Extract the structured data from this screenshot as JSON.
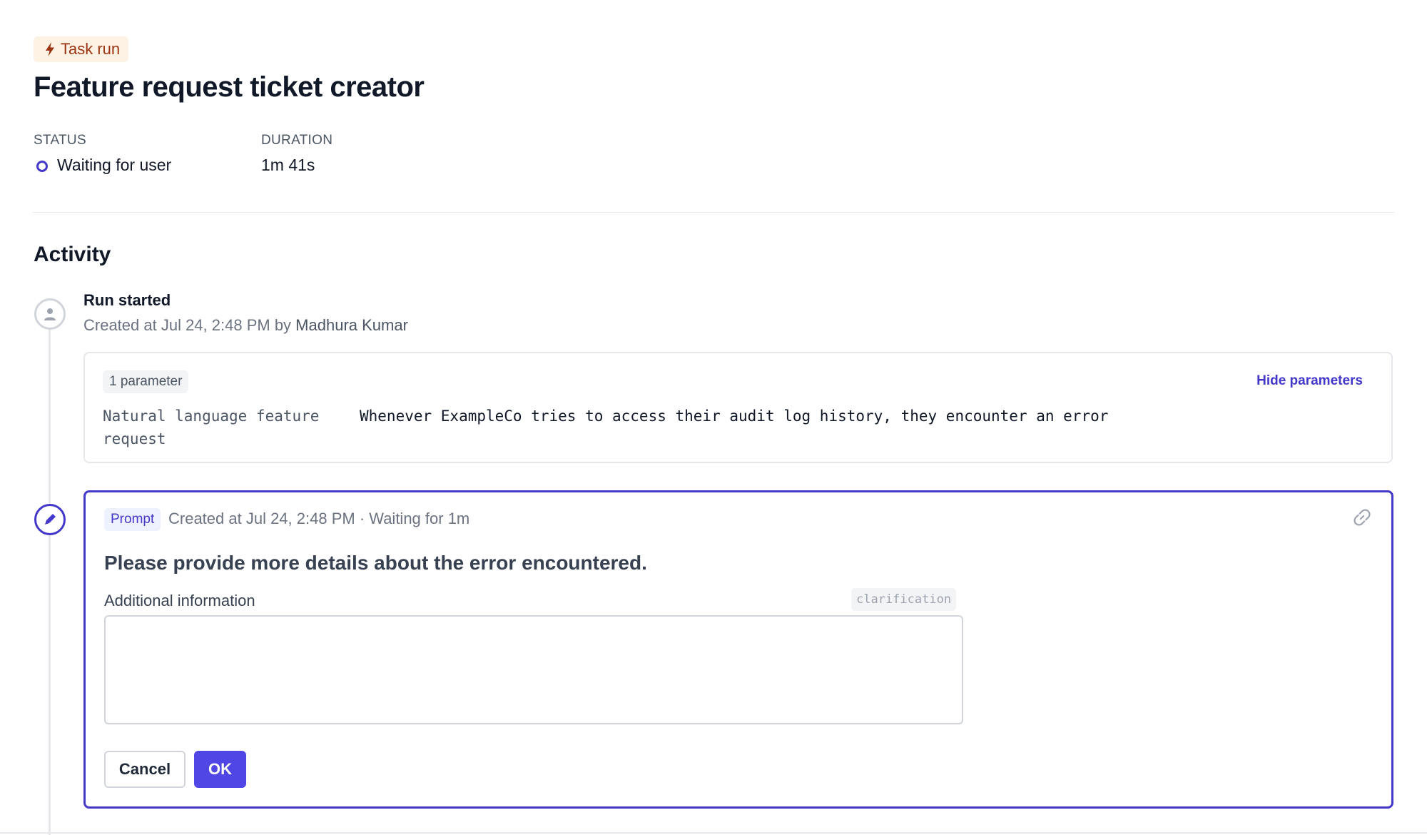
{
  "header": {
    "badge_label": "Task run",
    "badge_icon": "lightning-bolt-icon",
    "title": "Feature request ticket creator"
  },
  "meta": {
    "status_label": "STATUS",
    "status_value": "Waiting for user",
    "duration_label": "DURATION",
    "duration_value": "1m 41s"
  },
  "activity": {
    "section_title": "Activity",
    "run_started": {
      "title": "Run started",
      "subtitle_prefix": "Created at Jul 24, 2:48 PM by ",
      "user": "Madhura Kumar",
      "parameters": {
        "count_label": "1 parameter",
        "toggle_label": "Hide parameters",
        "items": [
          {
            "key": "Natural language feature request",
            "value": "Whenever ExampleCo tries to access their audit log history, they encounter an error"
          }
        ]
      }
    },
    "prompt": {
      "chip_label": "Prompt",
      "meta": "Created at Jul 24, 2:48 PM · Waiting for 1m",
      "question": "Please provide more details about the error encountered.",
      "field_label": "Additional information",
      "field_tag": "clarification",
      "field_value": "",
      "cancel_label": "Cancel",
      "ok_label": "OK"
    }
  },
  "colors": {
    "accent": "#4338ca",
    "primary_button": "#4f46e5",
    "badge_bg": "#fdf2e4",
    "badge_text": "#9a3412"
  }
}
